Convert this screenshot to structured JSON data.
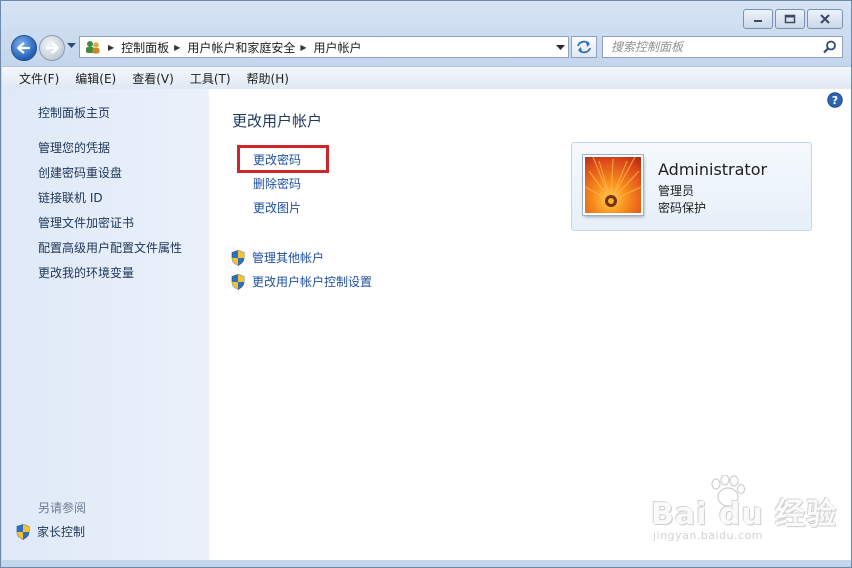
{
  "window": {
    "caption_buttons": [
      "minimize-icon",
      "maximize-icon",
      "close-icon"
    ]
  },
  "nav": {
    "breadcrumbs": [
      "控制面板",
      "用户帐户和家庭安全",
      "用户帐户"
    ],
    "search_placeholder": "搜索控制面板"
  },
  "menu": [
    "文件(F)",
    "编辑(E)",
    "查看(V)",
    "工具(T)",
    "帮助(H)"
  ],
  "sidebar": {
    "items": [
      "控制面板主页",
      "管理您的凭据",
      "创建密码重设盘",
      "链接联机 ID",
      "管理文件加密证书",
      "配置高级用户配置文件属性",
      "更改我的环境变量"
    ],
    "see_also_title": "另请参阅",
    "see_also_items": [
      "家长控制"
    ]
  },
  "main": {
    "heading": "更改用户帐户",
    "tasks": [
      "更改密码",
      "删除密码",
      "更改图片"
    ],
    "admin_tasks": [
      "管理其他帐户",
      "更改用户帐户控制设置"
    ]
  },
  "account": {
    "name": "Administrator",
    "role": "管理员",
    "status": "密码保护"
  },
  "watermark": {
    "brand": "Bai du 经验",
    "url": "jingyan.baidu.com"
  },
  "colors": {
    "link": "#1e50a2",
    "highlight_box": "#d0252b",
    "sidebar_text": "#1c3558"
  }
}
